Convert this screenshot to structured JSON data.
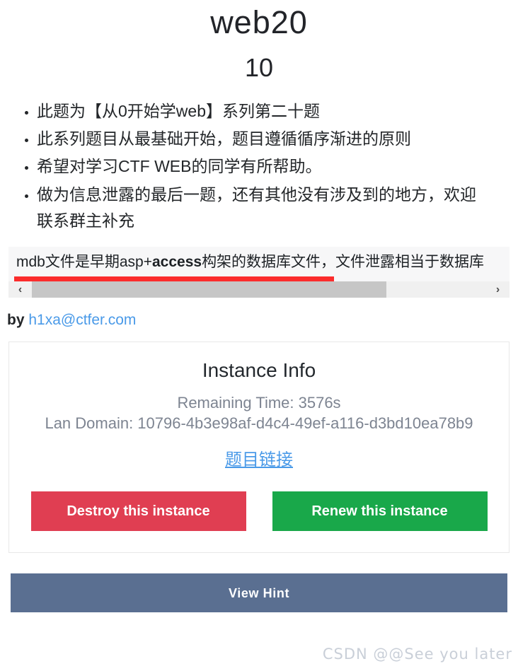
{
  "challenge": {
    "title": "web20",
    "score": "10",
    "description_items": [
      "此题为【从0开始学web】系列第二十题",
      "此系列题目从最基础开始，题目遵循循序渐进的原则",
      "希望对学习CTF WEB的同学有所帮助。",
      "做为信息泄露的最后一题，还有其他没有涉及到的地方，欢迎联系群主补充"
    ],
    "code_box": {
      "text_prefix": "mdb文件是早期asp+",
      "text_bold": "access",
      "text_suffix": "构架的数据库文件，文件泄露相当于数据库",
      "highlight_color": "#fb2c2c"
    },
    "author_prefix": "by ",
    "author_email": "h1xa@ctfer.com"
  },
  "scrollbar": {
    "left_arrow": "‹",
    "right_arrow": "›"
  },
  "instance": {
    "heading": "Instance Info",
    "remaining_time": "Remaining Time: 3576s",
    "lan_domain": "Lan Domain: 10796-4b3e98af-d4c4-49ef-a116-d3bd10ea78b9",
    "challenge_link_label": "题目链接",
    "destroy_button": "Destroy this instance",
    "renew_button": "Renew this instance",
    "destroy_color": "#e03e52",
    "renew_color": "#19a84a"
  },
  "hint": {
    "button_label": "View Hint",
    "button_color": "#5a6f91"
  },
  "watermark": {
    "text": "CSDN @@See you  later"
  }
}
